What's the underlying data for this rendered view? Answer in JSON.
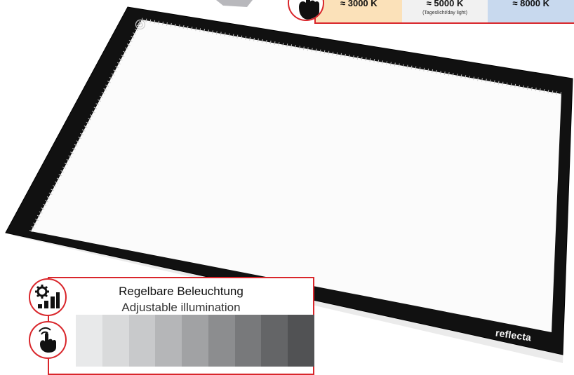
{
  "brand": {
    "logo_text": "reflecta"
  },
  "color_temperature": {
    "options": [
      {
        "value": "≈ 3000 K",
        "note": ""
      },
      {
        "value": "≈ 5000 K",
        "note": "(Tageslicht/day light)"
      },
      {
        "value": "≈ 8000 K",
        "note": ""
      }
    ],
    "icon": "hand-touch-icon"
  },
  "illumination": {
    "title": "Regelbare Beleuchtung",
    "subtitle": "Adjustable illumination",
    "icons": [
      "brightness-settings-icon",
      "hand-touch-icon"
    ],
    "gray_levels": [
      "#e8e9ea",
      "#d9dadb",
      "#c8c9cb",
      "#b5b6b8",
      "#a1a2a4",
      "#8c8d8f",
      "#78797b",
      "#646567",
      "#515254"
    ]
  },
  "colors": {
    "accent": "#d9262b",
    "frame": "#111111",
    "warm": "#fbe1b9",
    "neutral": "#f1f1f1",
    "cool": "#c8d9ee"
  }
}
